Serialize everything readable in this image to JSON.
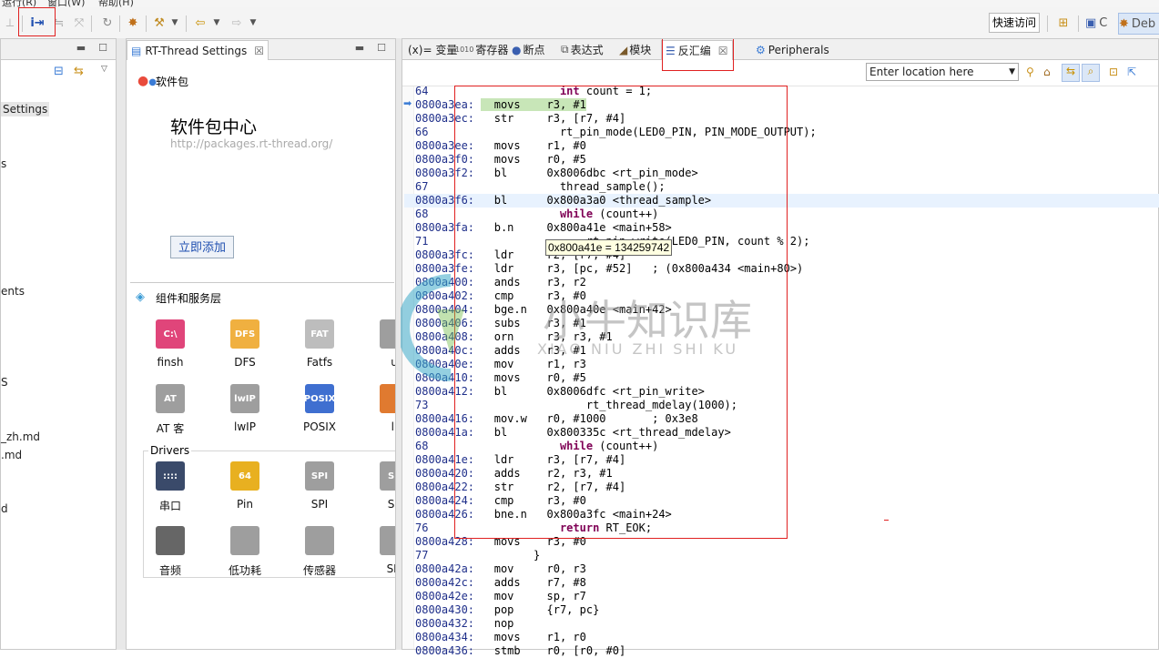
{
  "menubar": {
    "items": [
      "运行(R)",
      "窗口(W)",
      "帮助(H)"
    ]
  },
  "toolbar": {
    "quick_access": "快速访问",
    "perspective_c": "C",
    "perspective_debug": "Deb"
  },
  "left_pane": {
    "items": [
      "Settings",
      "s",
      "ents",
      "S",
      "_zh.md",
      ".md",
      "d"
    ]
  },
  "settings_pane": {
    "tab_title": "RT-Thread Settings",
    "package_header": "软件包",
    "center_title": "软件包中心",
    "center_url": "http://packages.rt-thread.org/",
    "add_button": "立即添加",
    "components_header": "组件和服务层",
    "components": [
      {
        "label": "finsh",
        "icon_text": "C:\\",
        "color": "#e0457a"
      },
      {
        "label": "DFS",
        "icon_text": "DFS",
        "color": "#f0b040"
      },
      {
        "label": "Fatfs",
        "icon_text": "FAT",
        "color": "#bdbdbd"
      },
      {
        "label": "u",
        "icon_text": "",
        "color": "#9e9e9e"
      },
      {
        "label": "AT 客",
        "icon_text": "AT",
        "color": "#9e9e9e"
      },
      {
        "label": "lwIP",
        "icon_text": "lwIP",
        "color": "#9e9e9e"
      },
      {
        "label": "POSIX",
        "icon_text": "POSIX",
        "color": "#3f6fd0"
      },
      {
        "label": "li",
        "icon_text": "",
        "color": "#e07a30"
      }
    ],
    "drivers_header": "Drivers",
    "drivers": [
      {
        "label": "串口",
        "icon_text": "::::",
        "color": "#3a4a6a"
      },
      {
        "label": "Pin",
        "icon_text": "64",
        "color": "#e8b020"
      },
      {
        "label": "SPI",
        "icon_text": "SPI",
        "color": "#9e9e9e"
      },
      {
        "label": "SF",
        "icon_text": "SF",
        "color": "#9e9e9e"
      },
      {
        "label": "音频",
        "icon_text": "",
        "color": "#666666"
      },
      {
        "label": "低功耗",
        "icon_text": "",
        "color": "#9e9e9e"
      },
      {
        "label": "传感器",
        "icon_text": "",
        "color": "#9e9e9e"
      },
      {
        "label": "SD",
        "icon_text": "",
        "color": "#9e9e9e"
      }
    ]
  },
  "debug_pane": {
    "tabs": [
      {
        "label": "(x)= 变量"
      },
      {
        "label": "寄存器"
      },
      {
        "label": "断点"
      },
      {
        "label": "表达式"
      },
      {
        "label": "模块"
      },
      {
        "label": "反汇编"
      },
      {
        "label": "Peripherals"
      }
    ],
    "location_placeholder": "Enter location here",
    "tooltip": "0x800a41e = 134259742",
    "watermark": {
      "cn": "小牛知识库",
      "en": "XIAO NIU ZHI SHI KU"
    }
  },
  "disassembly": [
    {
      "a": "64",
      "t": "            int count = 1;",
      "type": "src"
    },
    {
      "a": "0800a3ea:",
      "t": "  movs    r3, #1",
      "type": "asm",
      "hl": true
    },
    {
      "a": "0800a3ec:",
      "t": "  str     r3, [r7, #4]",
      "type": "asm"
    },
    {
      "a": "66",
      "t": "            rt_pin_mode(LED0_PIN, PIN_MODE_OUTPUT);",
      "type": "src"
    },
    {
      "a": "0800a3ee:",
      "t": "  movs    r1, #0",
      "type": "asm"
    },
    {
      "a": "0800a3f0:",
      "t": "  movs    r0, #5",
      "type": "asm"
    },
    {
      "a": "0800a3f2:",
      "t": "  bl      0x8006dbc <rt_pin_mode>",
      "type": "asm"
    },
    {
      "a": "67",
      "t": "            thread_sample();",
      "type": "src"
    },
    {
      "a": "0800a3f6:",
      "t": "  bl      0x800a3a0 <thread_sample>",
      "type": "asm",
      "cur": true
    },
    {
      "a": "68",
      "t": "            while (count++)",
      "type": "src"
    },
    {
      "a": "0800a3fa:",
      "t": "  b.n     0x800a41e <main+58>",
      "type": "asm"
    },
    {
      "a": "71",
      "t": "                rt_pin_write(LED0_PIN, count % 2);",
      "type": "src"
    },
    {
      "a": "0800a3fc:",
      "t": "  ldr     r2, [r7, #4]",
      "type": "asm"
    },
    {
      "a": "0800a3fe:",
      "t": "  ldr     r3, [pc, #52]   ; (0x800a434 <main+80>)",
      "type": "asm"
    },
    {
      "a": "0800a400:",
      "t": "  ands    r3, r2",
      "type": "asm"
    },
    {
      "a": "0800a402:",
      "t": "  cmp     r3, #0",
      "type": "asm"
    },
    {
      "a": "0800a404:",
      "t": "  bge.n   0x800a40e <main+42>",
      "type": "asm"
    },
    {
      "a": "0800a406:",
      "t": "  subs    r3, #1",
      "type": "asm"
    },
    {
      "a": "0800a408:",
      "t": "  orn     r3, r3, #1",
      "type": "asm"
    },
    {
      "a": "0800a40c:",
      "t": "  adds    r3, #1",
      "type": "asm"
    },
    {
      "a": "0800a40e:",
      "t": "  mov     r1, r3",
      "type": "asm"
    },
    {
      "a": "0800a410:",
      "t": "  movs    r0, #5",
      "type": "asm"
    },
    {
      "a": "0800a412:",
      "t": "  bl      0x8006dfc <rt_pin_write>",
      "type": "asm"
    },
    {
      "a": "73",
      "t": "                rt_thread_mdelay(1000);",
      "type": "src"
    },
    {
      "a": "0800a416:",
      "t": "  mov.w   r0, #1000       ; 0x3e8",
      "type": "asm"
    },
    {
      "a": "0800a41a:",
      "t": "  bl      0x800335c <rt_thread_mdelay>",
      "type": "asm"
    },
    {
      "a": "68",
      "t": "            while (count++)",
      "type": "src"
    },
    {
      "a": "0800a41e:",
      "t": "  ldr     r3, [r7, #4]",
      "type": "asm"
    },
    {
      "a": "0800a420:",
      "t": "  adds    r2, r3, #1",
      "type": "asm"
    },
    {
      "a": "0800a422:",
      "t": "  str     r2, [r7, #4]",
      "type": "asm"
    },
    {
      "a": "0800a424:",
      "t": "  cmp     r3, #0",
      "type": "asm"
    },
    {
      "a": "0800a426:",
      "t": "  bne.n   0x800a3fc <main+24>",
      "type": "asm"
    },
    {
      "a": "76",
      "t": "            return RT_EOK;",
      "type": "src"
    },
    {
      "a": "0800a428:",
      "t": "  movs    r3, #0",
      "type": "asm"
    },
    {
      "a": "77",
      "t": "        }",
      "type": "src"
    },
    {
      "a": "0800a42a:",
      "t": "  mov     r0, r3",
      "type": "asm"
    },
    {
      "a": "0800a42c:",
      "t": "  adds    r7, #8",
      "type": "asm"
    },
    {
      "a": "0800a42e:",
      "t": "  mov     sp, r7",
      "type": "asm"
    },
    {
      "a": "0800a430:",
      "t": "  pop     {r7, pc}",
      "type": "asm"
    },
    {
      "a": "0800a432:",
      "t": "  nop",
      "type": "asm"
    },
    {
      "a": "0800a434:",
      "t": "  movs    r1, r0",
      "type": "asm"
    },
    {
      "a": "0800a436:",
      "t": "  stmb    r0, [r0, #0]",
      "type": "asm"
    }
  ]
}
